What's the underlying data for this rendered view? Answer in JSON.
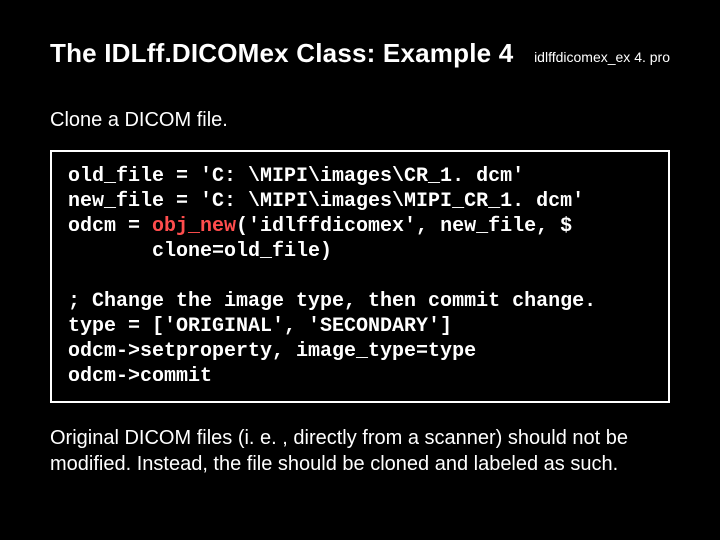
{
  "header": {
    "title": "The IDLff.DICOMex Class: Example 4",
    "filename": "idlffdicomex_ex 4. pro"
  },
  "subtitle": "Clone a DICOM file.",
  "code": {
    "l1a": "old_file = 'C: \\MIPI\\images\\CR_1. dcm'",
    "l2a": "new_file = 'C: \\MIPI\\images\\MIPI_CR_1. dcm'",
    "l3a": "odcm = ",
    "l3kw": "obj_new",
    "l3b": "('idlffdicomex', new_file, $",
    "l4a": "       clone=old_file)",
    "l6a": "; Change the image type, then commit change.",
    "l7a": "type = ['ORIGINAL', 'SECONDARY']",
    "l8a": "odcm->setproperty, image_type=type",
    "l9a": "odcm->commit"
  },
  "footer": "Original DICOM files (i. e. , directly from a scanner) should not be modified. Instead, the file should be cloned and labeled as such."
}
